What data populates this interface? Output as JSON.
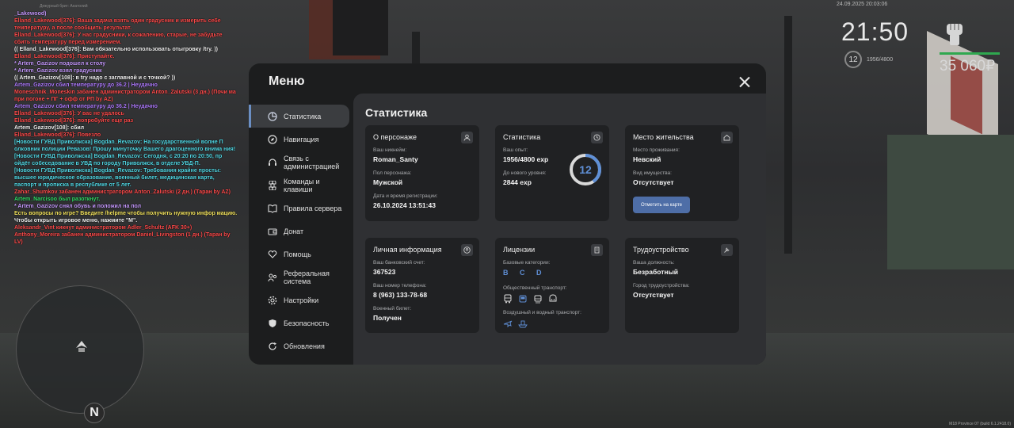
{
  "chat": {
    "header": "Дежурный бриг: Анатолий",
    "lines": [
      {
        "text": "_Lakewood)",
        "color": "violet"
      },
      {
        "text": "Elland_Lakewood[376]: Ваша задача взять один градусник и измерить себе температуру, а после сообщить результат.",
        "color": "red"
      },
      {
        "text": "Elland_Lakewood[376]: У нас градусники, к сожалению, старые, не забудьте сбить температуру перед измерением.",
        "color": "red"
      },
      {
        "text": "(( Elland_Lakewood[376]: Вам обязательно использовать отыгровку /try. ))",
        "color": "white"
      },
      {
        "text": "Elland_Lakewood[376]: Приступайте.",
        "color": "red"
      },
      {
        "text": "* Artem_Gazizov подошел к столу",
        "color": "violet"
      },
      {
        "text": "* Artem_Gazizov взял градусник",
        "color": "violet"
      },
      {
        "text": "(( Artem_Gazizov[108]: в try надо с заглавной и с точкой? ))",
        "color": "white"
      },
      {
        "text": "Artem_Gazizov сбил температуру до 36.2 | Неудачно",
        "color": "purple"
      },
      {
        "text": "Moneschnik_Moneskin забанен администратором Anton_Zalutski (3 дн.) (Почи ма при погоне + ПГ + офф от РП by AZ)",
        "color": "red"
      },
      {
        "text": "Artem_Gazizov сбил температуру до 36.2 | Неудачно",
        "color": "purple"
      },
      {
        "text": "Elland_Lakewood[376]: У вас не удалось",
        "color": "red"
      },
      {
        "text": "Elland_Lakewood[376]: попробуйте еще раз",
        "color": "red"
      },
      {
        "text": "Artem_Gazizov[108]: сбил",
        "color": "white"
      },
      {
        "text": "Elland_Lakewood[376]: Повезло",
        "color": "red"
      },
      {
        "text": "[Новости ГУВД Приволжска] Bogdan_Revazov: На государственной волне П олковник полиции Ревазов! Прошу минуточку Вашего драгоценного внима ния!",
        "color": "cyan"
      },
      {
        "text": "[Новости ГУВД Приволжска] Bogdan_Revazov: Сегодня, с 20:20 по 20:50, пр ойдёт собеседование в УВД по городу Приволжск, в отделе УВД-П.",
        "color": "cyan"
      },
      {
        "text": "[Новости ГУВД Приволжска] Bogdan_Revazov: Требования крайне просты: высшее юридическое образование, военный билет, медицинская карта, паспорт и прописка в республике от 5 лет.",
        "color": "cyan"
      },
      {
        "text": "Zahar_Shumkov забанен администратором Anton_Zalutski (2 дн.) (Таран by AZ)",
        "color": "red"
      },
      {
        "text": "Artem_Narcisoo был разоткнут.",
        "color": "green"
      },
      {
        "text": "* Artem_Gazizov снял обувь и положил на пол",
        "color": "violet"
      },
      {
        "text": "Есть вопросы по игре? Введите /helpme чтобы получить нужную инфор мацию.",
        "color": "yellow"
      },
      {
        "text": "Чтобы открыть игровое меню, нажмите \"M\".",
        "color": "white"
      },
      {
        "text": "Aleksandr_Vint кикнут администратором Adler_Schultz (AFK 30+)",
        "color": "red"
      },
      {
        "text": "Anthony_Moreira забанен администратором Daniel_Livingston (1 дн.) (Таран by LV)",
        "color": "red"
      }
    ]
  },
  "hud": {
    "date": "24.09.2025 20:03:06",
    "time": "21:50",
    "level": "12",
    "exp": "1956/4800",
    "money": "35 060₽",
    "build": "M18 Province 07 (build 6.1.2418.0)",
    "compass": "N"
  },
  "menu": {
    "title": "Меню",
    "nav": [
      {
        "label": "Статистика",
        "icon": "pie-chart-icon",
        "active": true
      },
      {
        "label": "Навигация",
        "icon": "compass-icon"
      },
      {
        "label": "Связь с администрацией",
        "icon": "headset-icon"
      },
      {
        "label": "Команды и клавиши",
        "icon": "command-icon"
      },
      {
        "label": "Правила сервера",
        "icon": "book-icon"
      },
      {
        "label": "Донат",
        "icon": "wallet-icon"
      },
      {
        "label": "Помощь",
        "icon": "heart-hands-icon"
      },
      {
        "label": "Реферальная система",
        "icon": "referral-icon"
      },
      {
        "label": "Настройки",
        "icon": "gear-icon"
      },
      {
        "label": "Безопасность",
        "icon": "shield-icon"
      },
      {
        "label": "Обновления",
        "icon": "refresh-icon"
      }
    ],
    "content_title": "Статистика",
    "about": {
      "title": "О персонаже",
      "nick_label": "Ваш никнейм:",
      "nick": "Roman_Santy",
      "gender_label": "Пол персонажа:",
      "gender": "Мужской",
      "reg_label": "Дата и время регистрации:",
      "reg": "26.10.2024 13:51:43"
    },
    "stats": {
      "title": "Статистика",
      "exp_label": "Ваш опыт:",
      "exp": "1956/4800 exp",
      "next_label": "До нового уровня:",
      "next": "2844 exp",
      "level": "12",
      "progress": 0.4075
    },
    "residence": {
      "title": "Место жительства",
      "place_label": "Место проживания:",
      "place": "Невский",
      "property_label": "Вид имущества:",
      "property": "Отсутствует",
      "map_button": "Отметить на карте"
    },
    "personal": {
      "title": "Личная информация",
      "bank_label": "Ваш банковский счет:",
      "bank": "367523",
      "phone_label": "Ваш номер телефона:",
      "phone": "8 (963) 133-78-68",
      "military_label": "Военный билет:",
      "military": "Получен"
    },
    "licenses": {
      "title": "Лицензии",
      "basic_label": "Базовые категории:",
      "basic": "B C D",
      "public_label": "Общественный транспорт:",
      "air_label": "Воздушный и водный транспорт:"
    },
    "job": {
      "title": "Трудоустройство",
      "position_label": "Ваша должность:",
      "position": "Безработный",
      "city_label": "Город трудоустройства:",
      "city": "Отсутствует"
    }
  },
  "colors": {
    "accent": "#5f8fd6",
    "button": "#4e6ea7",
    "modal_bg": "#1c1d1e",
    "content_bg": "#2f3033",
    "card_bg": "#202123",
    "money_bar": "#2fa84f"
  }
}
